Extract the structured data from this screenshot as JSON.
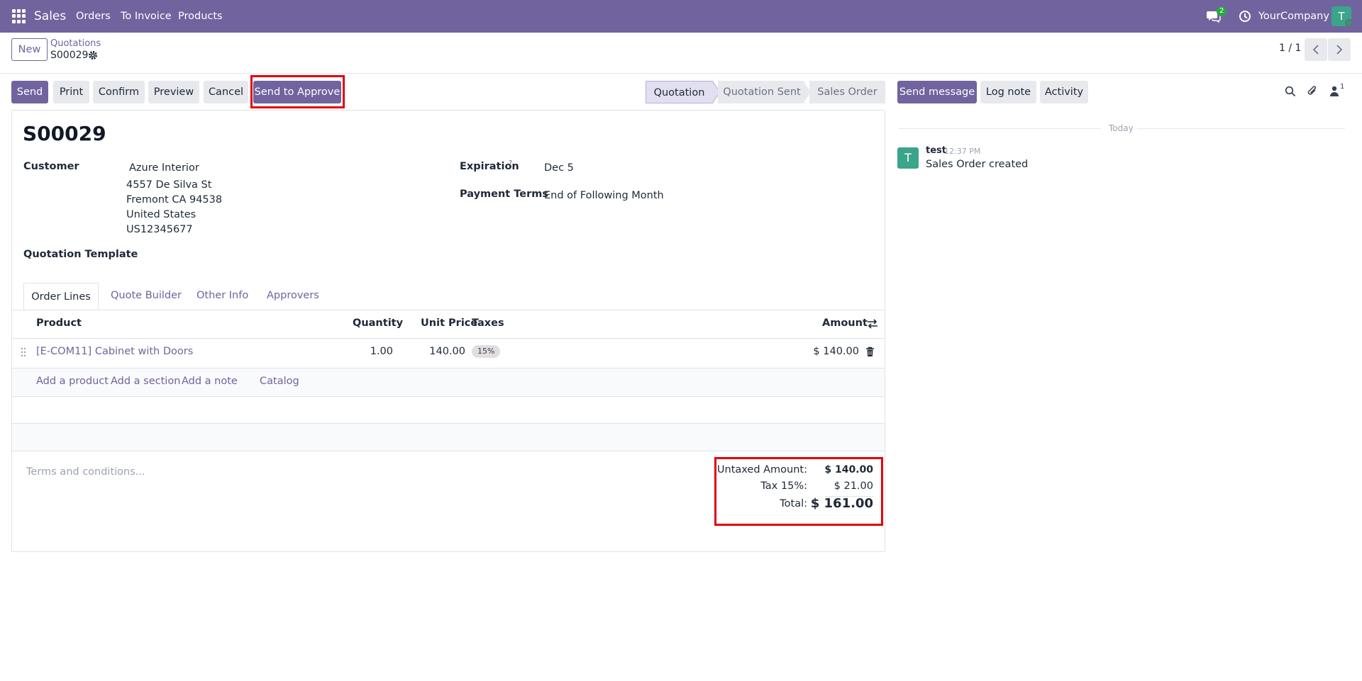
{
  "nav": {
    "app_name": "Sales",
    "menu": [
      "Orders",
      "To Invoice",
      "Products"
    ],
    "messages_count": "2",
    "company": "YourCompany",
    "user_initial": "T"
  },
  "control": {
    "new_label": "New",
    "breadcrumb_parent": "Quotations",
    "record_name": "S00029",
    "pager": "1 / 1",
    "buttons": {
      "send": "Send",
      "print": "Print",
      "confirm": "Confirm",
      "preview": "Preview",
      "cancel": "Cancel",
      "send_to_approve": "Send to Approve"
    },
    "statusbar": [
      "Quotation",
      "Quotation Sent",
      "Sales Order"
    ],
    "active_status": "Quotation"
  },
  "form": {
    "title": "S00029",
    "customer_label": "Customer",
    "customer_name": "Azure Interior",
    "customer_address": [
      "4557 De Silva St",
      "Fremont CA 94538",
      "United States",
      "US12345677"
    ],
    "expiration_label": "Expiration",
    "expiration_help": "?",
    "expiration_value": "Dec 5",
    "payment_terms_label": "Payment Terms",
    "payment_terms_value": "End of Following Month",
    "quotation_template_label": "Quotation Template",
    "tabs": [
      "Order Lines",
      "Quote Builder",
      "Other Info",
      "Approvers"
    ],
    "active_tab": "Order Lines",
    "columns": [
      "Product",
      "Quantity",
      "Unit Price",
      "Taxes",
      "Amount"
    ],
    "lines": [
      {
        "product": "[E-COM11] Cabinet with Doors",
        "quantity": "1.00",
        "unit_price": "140.00",
        "tax": "15%",
        "amount": "$ 140.00"
      }
    ],
    "add_actions": [
      "Add a product",
      "Add a section",
      "Add a note",
      "Catalog"
    ],
    "terms_placeholder": "Terms and conditions...",
    "totals": {
      "untaxed_label": "Untaxed Amount:",
      "untaxed_value": "$ 140.00",
      "tax_label": "Tax 15%:",
      "tax_value": "$ 21.00",
      "total_label": "Total:",
      "total_value": "$ 161.00"
    }
  },
  "chatter": {
    "send_message": "Send message",
    "log_note": "Log note",
    "activity": "Activity",
    "followers_count": "1",
    "date_separator": "Today",
    "messages": [
      {
        "author": "test",
        "time": "12:37 PM",
        "body": "Sales Order created",
        "initial": "T"
      }
    ]
  },
  "colors": {
    "brand": "#71639e",
    "highlight": "#e3000f",
    "avatar": "#3aa58a"
  }
}
